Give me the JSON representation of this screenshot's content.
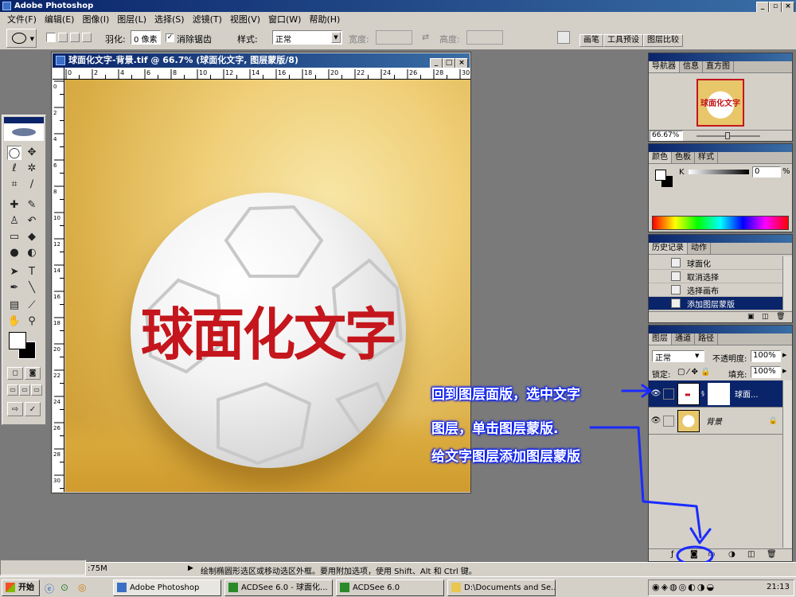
{
  "app": {
    "title": "Adobe Photoshop"
  },
  "menu": [
    "文件(F)",
    "编辑(E)",
    "图像(I)",
    "图层(L)",
    "选择(S)",
    "滤镜(T)",
    "视图(V)",
    "窗口(W)",
    "帮助(H)"
  ],
  "options": {
    "feather_label": "羽化:",
    "feather_value": "0 像素",
    "antialias_label": "消除锯齿",
    "style_label": "样式:",
    "style_value": "正常",
    "width_label": "宽度:",
    "height_label": "高度:",
    "palette_tabs": [
      "画笔",
      "工具预设",
      "图层比较"
    ]
  },
  "document": {
    "title": "球面化文字-背景.tif @ 66.7% (球面化文字, 图层蒙版/8)",
    "ruler_numbers": [
      "0",
      "2",
      "4",
      "6",
      "8",
      "10",
      "12",
      "14",
      "16",
      "18",
      "20",
      "22",
      "24",
      "26",
      "28",
      "30"
    ],
    "ruler_left_numbers": [
      "0",
      "2",
      "4",
      "6",
      "8",
      "10",
      "12",
      "14",
      "16",
      "18",
      "20",
      "22",
      "24",
      "26",
      "28",
      "30"
    ],
    "ball_text": "球面化文字"
  },
  "navigator": {
    "tabs": [
      "导航器",
      "信息",
      "直方图"
    ],
    "thumb_text": "球面化文字",
    "zoom": "66.67%"
  },
  "color": {
    "tabs": [
      "颜色",
      "色板",
      "样式"
    ],
    "channel": "K",
    "value": "0",
    "unit": "%"
  },
  "history": {
    "tabs": [
      "历史记录",
      "动作"
    ],
    "items": [
      {
        "label": "球面化",
        "selected": false
      },
      {
        "label": "取消选择",
        "selected": false
      },
      {
        "label": "选择画布",
        "selected": false
      },
      {
        "label": "添加图层蒙版",
        "selected": true
      }
    ]
  },
  "layers": {
    "tabs": [
      "图层",
      "通道",
      "路径"
    ],
    "blend_mode": "正常",
    "opacity_label": "不透明度:",
    "opacity": "100%",
    "lock_label": "锁定:",
    "fill_label": "填充:",
    "fill": "100%",
    "items": [
      {
        "name": "球面...",
        "selected": true
      },
      {
        "name": "背景",
        "selected": false
      }
    ]
  },
  "annotations": {
    "line1": "回到图层面版，选中文字",
    "line2": "图层，单击图层蒙版.",
    "line3": "给文字图层添加图层蒙版"
  },
  "status": {
    "doc_size": ":75M",
    "hint": "绘制椭圆形选区或移动选区外框。要用附加选项，使用 Shift、Alt 和 Ctrl 键。"
  },
  "taskbar": {
    "start": "开始",
    "buttons": [
      "Adobe Photoshop",
      "ACDSee 6.0 - 球面化...",
      "ACDSee 6.0",
      "D:\\Documents and Se..."
    ],
    "clock": "21:13"
  },
  "colors": {
    "annotation": "#0018ff",
    "title_blue": "#0a246a",
    "text_red": "#c4161c"
  }
}
